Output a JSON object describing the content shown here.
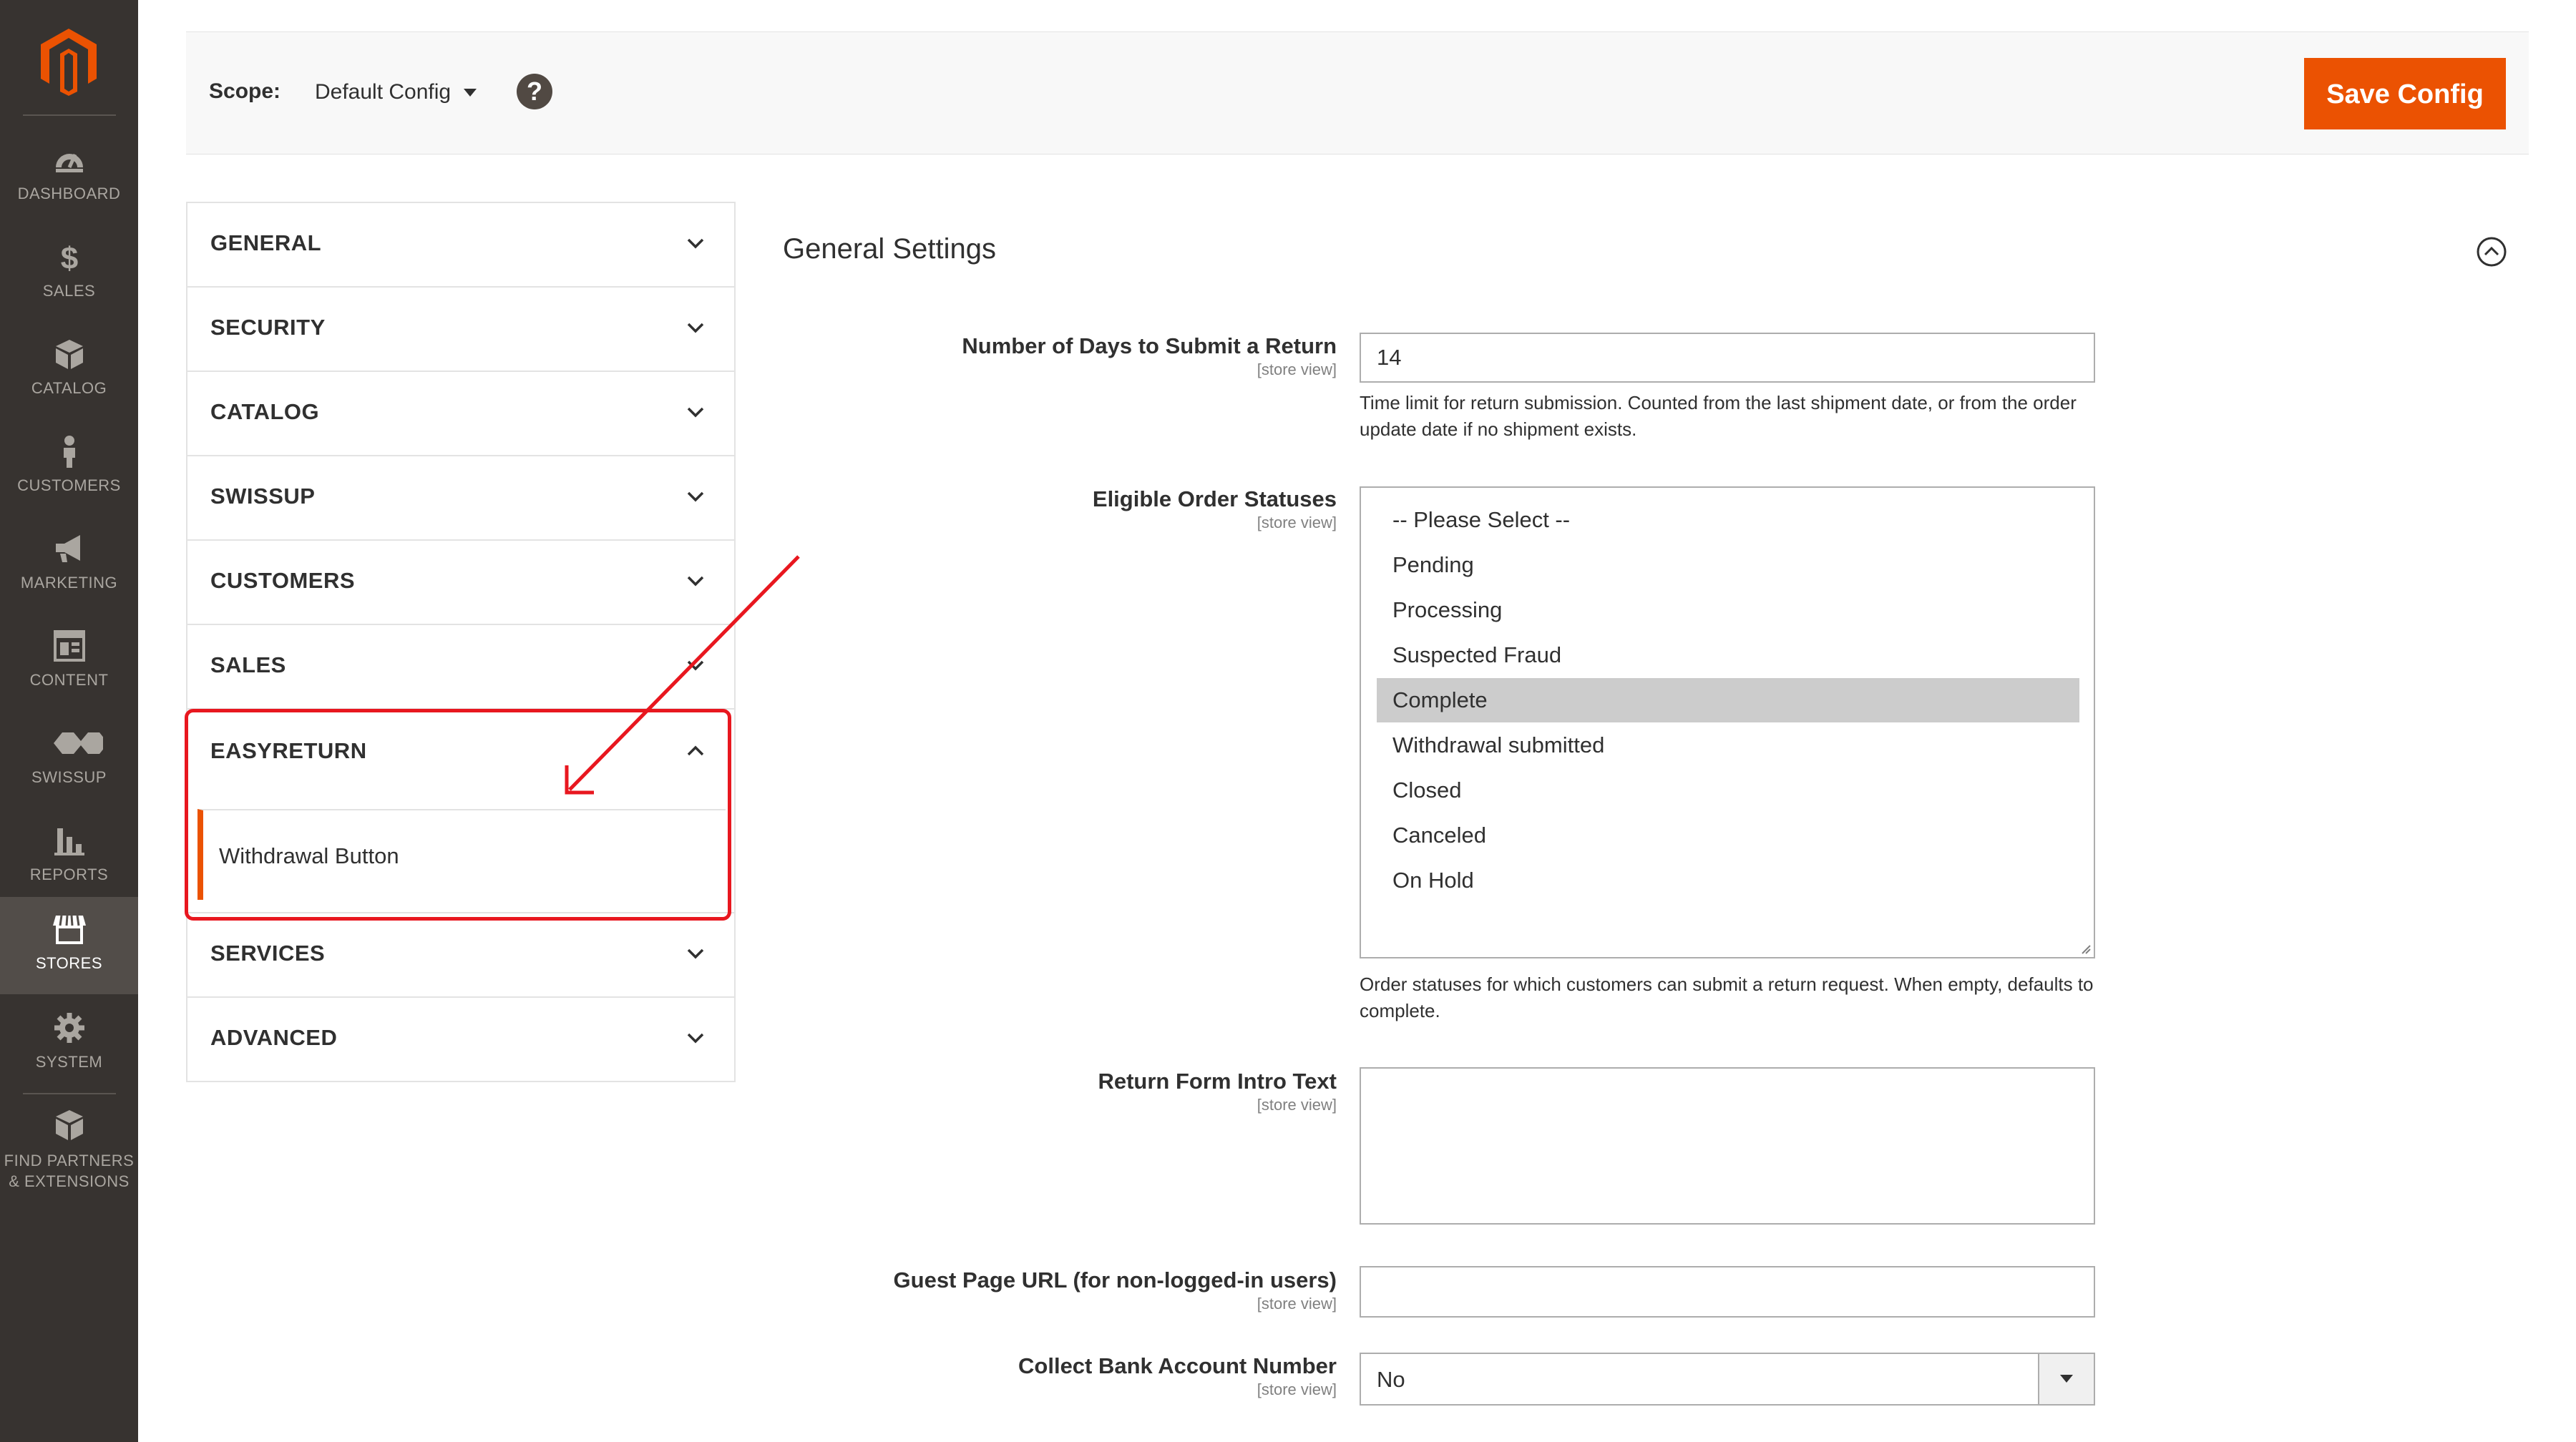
{
  "nav": {
    "items": [
      {
        "label": "DASHBOARD",
        "icon": "dashboard-icon"
      },
      {
        "label": "SALES",
        "icon": "dollar-icon"
      },
      {
        "label": "CATALOG",
        "icon": "cube-icon"
      },
      {
        "label": "CUSTOMERS",
        "icon": "person-icon"
      },
      {
        "label": "MARKETING",
        "icon": "megaphone-icon"
      },
      {
        "label": "CONTENT",
        "icon": "layout-icon"
      },
      {
        "label": "SWISSUP",
        "icon": "swissup-icon"
      },
      {
        "label": "REPORTS",
        "icon": "bar-chart-icon"
      },
      {
        "label": "STORES",
        "icon": "store-icon"
      },
      {
        "label": "SYSTEM",
        "icon": "gear-icon"
      },
      {
        "label": "FIND PARTNERS",
        "label2": "& EXTENSIONS",
        "icon": "boxes-icon"
      }
    ],
    "active": "STORES",
    "brand_color": "#eb5202"
  },
  "header": {
    "scope_label": "Scope:",
    "scope_value": "Default Config",
    "help_glyph": "?",
    "save_label": "Save Config"
  },
  "tabs": {
    "general": "GENERAL",
    "security": "SECURITY",
    "catalog": "CATALOG",
    "swissup": "SWISSUP",
    "customers": "CUSTOMERS",
    "sales": "SALES",
    "easyreturn": "EASYRETURN",
    "easyreturn_sub": "Withdrawal Button",
    "services": "SERVICES",
    "advanced": "ADVANCED"
  },
  "section": {
    "title": "General Settings",
    "fields": {
      "days": {
        "label": "Number of Days to Submit a Return",
        "scope": "[store view]",
        "value": "14",
        "note": "Time limit for return submission. Counted from the last shipment date, or from the order update date if no shipment exists."
      },
      "statuses": {
        "label": "Eligible Order Statuses",
        "scope": "[store view]",
        "options": [
          "-- Please Select --",
          "Pending",
          "Processing",
          "Suspected Fraud",
          "Complete",
          "Withdrawal submitted",
          "Closed",
          "Canceled",
          "On Hold"
        ],
        "selected": "Complete",
        "note": "Order statuses for which customers can submit a return request. When empty, defaults to complete."
      },
      "intro": {
        "label": "Return Form Intro Text",
        "scope": "[store view]",
        "value": ""
      },
      "guest_url": {
        "label": "Guest Page URL (for non-logged-in users)",
        "scope": "[store view]",
        "value": ""
      },
      "bank": {
        "label": "Collect Bank Account Number",
        "scope": "[store view]",
        "value": "No"
      }
    }
  },
  "annotation_color": "#e8171f"
}
